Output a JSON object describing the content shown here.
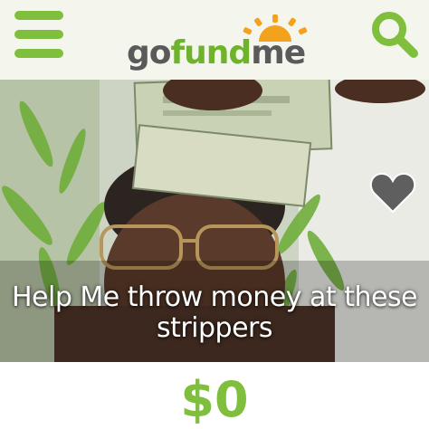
{
  "header": {
    "menu_icon": "hamburger-menu-icon",
    "logo": {
      "part1": "go",
      "part2": "fund",
      "part3": "me"
    },
    "search_icon": "search-icon"
  },
  "campaign": {
    "title": "Help Me throw money at these strippers",
    "amount_raised": "$0",
    "favorite_icon": "heart-icon"
  },
  "colors": {
    "brand_green": "#7fbf3d",
    "logo_gray": "#5a5a5a",
    "sun_orange": "#f4a11e",
    "heart_gray": "#5f5f5f"
  }
}
